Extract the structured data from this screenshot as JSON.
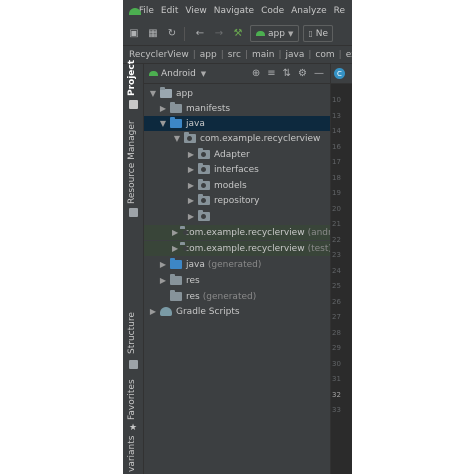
{
  "menu": {
    "items": [
      "File",
      "Edit",
      "View",
      "Navigate",
      "Code",
      "Analyze",
      "Re"
    ]
  },
  "toolbar": {
    "run_config": "app",
    "device_label": "Ne"
  },
  "breadcrumb": [
    "RecyclerView",
    "app",
    "src",
    "main",
    "java",
    "com",
    "exa"
  ],
  "tool_strip": {
    "project": "Project",
    "resource_manager": "Resource Manager",
    "structure": "Structure",
    "favorites": "Favorites",
    "variants": "variants"
  },
  "panel": {
    "view_mode": "Android"
  },
  "tree": {
    "app": "app",
    "manifests": "manifests",
    "java": "java",
    "package_main": "com.example.recyclerview",
    "adapter": "Adapter",
    "interfaces": "interfaces",
    "models": "models",
    "repository": "repository",
    "package_android_test": "com.example.recyclerview",
    "android_test_suffix": "(andro",
    "package_test": "com.example.recyclerview",
    "test_suffix": "(test)",
    "java_generated": "java",
    "java_generated_suffix": "(generated)",
    "res": "res",
    "res_generated": "res",
    "res_generated_suffix": "(generated)",
    "gradle_scripts": "Gradle Scripts"
  },
  "gutter": [
    "10",
    "13",
    "14",
    "16",
    "17",
    "18",
    "19",
    "20",
    "21",
    "22",
    "23",
    "24",
    "25",
    "26",
    "27",
    "28",
    "29",
    "30",
    "31",
    "32",
    "33"
  ],
  "colors": {
    "ide_bg": "#3c3f41",
    "editor_bg": "#2b2b2b",
    "selection": "#0d293e",
    "android_green": "#4caf50",
    "folder_blue": "#3d87c6"
  }
}
